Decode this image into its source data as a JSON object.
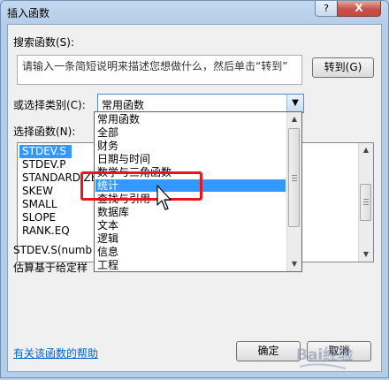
{
  "window": {
    "title": "插入函数",
    "help_glyph": "?",
    "close_glyph": "X"
  },
  "search": {
    "label": "搜索函数(S):",
    "text": "请输入一条简短说明来描述您想做什么，然后单击“转到”",
    "go_button": "转到(G)"
  },
  "category": {
    "label": "或选择类别(C):",
    "selected": "常用函数",
    "dropdown_items": [
      "常用函数",
      "全部",
      "财务",
      "日期与时间",
      "数学与三角函数",
      "统计",
      "查找与引用",
      "数据库",
      "文本",
      "逻辑",
      "信息",
      "工程"
    ],
    "highlighted_item": "统计"
  },
  "functions": {
    "label": "选择函数(N):",
    "items": [
      "STDEV.S",
      "STDEV.P",
      "STANDARDIZE",
      "SKEW",
      "SMALL",
      "SLOPE",
      "RANK.EQ"
    ],
    "selected": "STDEV.S",
    "signature": "STDEV.S(numb",
    "description": "估算基于给定样"
  },
  "footer": {
    "help_link": "有关该函数的帮助",
    "ok_button": "确定",
    "cancel_button": "取消"
  },
  "watermark": "Bai经验",
  "colors": {
    "highlight": "#3399ff",
    "annotation_box": "#e8141e",
    "link": "#0066cc"
  }
}
